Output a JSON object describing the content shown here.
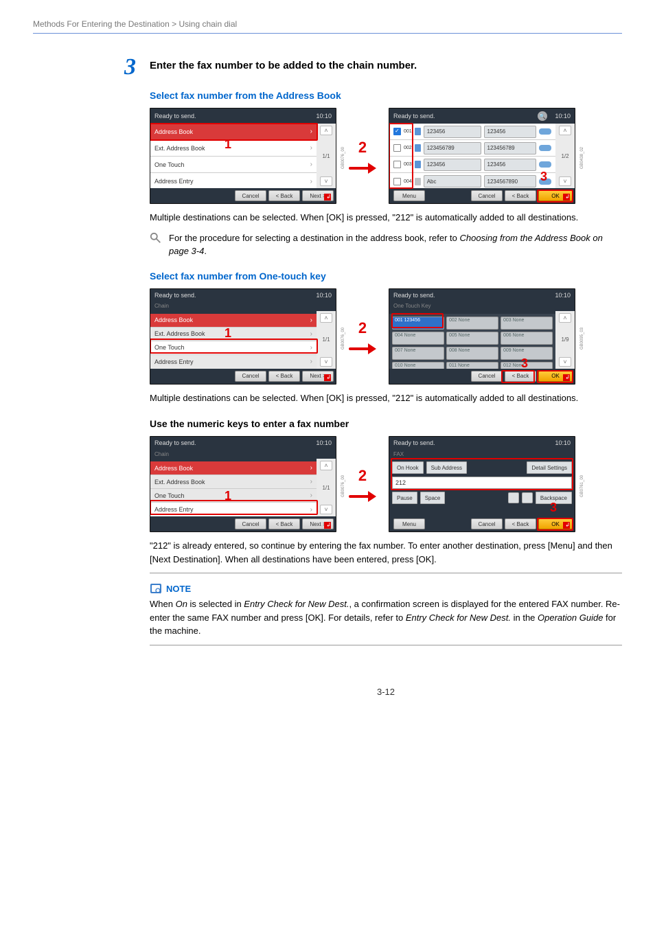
{
  "breadcrumb": "Methods For Entering the Destination > Using chain dial",
  "step_num": "3",
  "step_title": "Enter the fax number to be added to the chain number.",
  "sec_ab_title": "Select fax number from the Address Book",
  "sec_ot_title": "Select fax number from One-touch key",
  "sec_num_title": "Use the numeric keys to enter a fax number",
  "body_multi": "Multiple destinations can be selected. When [OK] is pressed, \"212\" is automatically added to all destinations.",
  "ref_prefix": "For the procedure for selecting a destination in the address book, refer to ",
  "ref_link": "Choosing from the Address Book on page 3-4",
  "ref_suffix": ".",
  "body_212": "\"212\" is already entered, so continue by entering the fax number. To enter another destination, press [Menu] and then [Next Destination]. When all destinations have been entered, press [OK].",
  "note_label": "NOTE",
  "note_p1a": "When ",
  "note_p1b": "On",
  "note_p1c": " is selected in ",
  "note_p1d": "Entry Check for New Dest.",
  "note_p1e": ", a confirmation screen is displayed for the entered FAX number. Re-enter the same FAX number and press [OK]. For details, refer to ",
  "note_p1f": "Entry Check for New Dest.",
  "note_p1g": " in the ",
  "note_p1h": "Operation Guide",
  "note_p1i": " for the machine.",
  "page_number": "3-12",
  "common": {
    "ready": "Ready to send.",
    "time": "10:10",
    "cancel": "Cancel",
    "back": "< Back",
    "next": "Next >",
    "ok": "OK",
    "menu": "Menu",
    "page11": "1/1",
    "page12": "1/2",
    "page19": "1/9"
  },
  "left_list": {
    "chain_lbl": "Chain",
    "rows": [
      "Address Book",
      "Ext. Address Book",
      "One Touch",
      "Address Entry"
    ]
  },
  "ab_right": {
    "items": [
      {
        "num": "001",
        "name": "123456",
        "fax": "123456",
        "checked": true
      },
      {
        "num": "002",
        "name": "123456789",
        "fax": "123456789",
        "checked": false
      },
      {
        "num": "003",
        "name": "123456",
        "fax": "123456",
        "checked": false
      },
      {
        "num": "004",
        "name": "Abc",
        "fax": "1234567890",
        "checked": false
      }
    ]
  },
  "ot_right": {
    "label": "One Touch Key",
    "cells": [
      "001 123456",
      "002 None",
      "003 None",
      "004 None",
      "005 None",
      "006 None",
      "007 None",
      "008 None",
      "009 None",
      "010 None",
      "011 None",
      "012 None"
    ]
  },
  "fax_right": {
    "label": "FAX",
    "onhook": "On Hook",
    "subaddr": "Sub Address",
    "detail": "Detail Settings",
    "value": "212",
    "pause": "Pause",
    "space": "Space",
    "backspace": "Backspace"
  },
  "sidecodes": {
    "a": "GB0076_00",
    "b": "GB0438_02",
    "c": "GB0095_03",
    "d": "GB0761_00"
  },
  "callouts": {
    "n1": "1",
    "n2": "2",
    "n3": "3"
  },
  "chart_data": null
}
